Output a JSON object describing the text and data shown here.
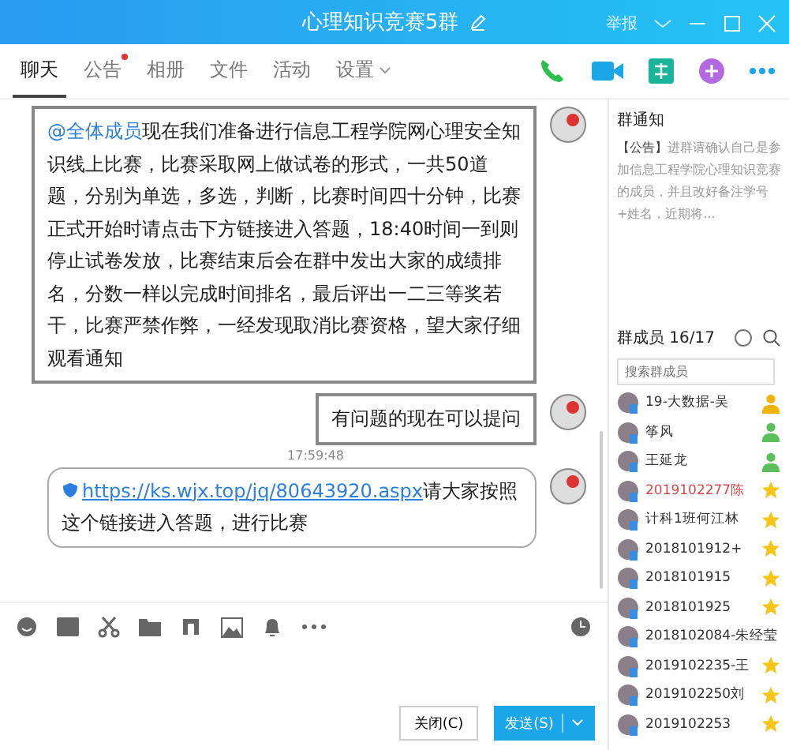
{
  "window": {
    "title": "心理知识竞赛5群",
    "menu_label": "举报"
  },
  "tabs": [
    {
      "label": "聊天",
      "selected": true,
      "badge": false
    },
    {
      "label": "公告",
      "selected": false,
      "badge": true
    },
    {
      "label": "相册",
      "selected": false,
      "badge": false
    },
    {
      "label": "文件",
      "selected": false,
      "badge": false
    },
    {
      "label": "活动",
      "selected": false,
      "badge": false
    },
    {
      "label": "设置",
      "selected": false,
      "badge": false,
      "dropdown": true
    }
  ],
  "messages": [
    {
      "kind": "notice",
      "mention": "@全体成员",
      "text": "现在我们准备进行信息工程学院网心理安全知识线上比赛，比赛采取网上做试卷的形式，一共50道题，分别为单选，多选，判断，比赛时间四十分钟，比赛正式开始时请点击下方链接进入答题，18:40时间一到则停止试卷发放，比赛结束后会在群中发出大家的成绩排名，分数一样以完成时间排名，最后评出一二三等奖若干，比赛严禁作弊，一经发现取消比赛资格，望大家仔细观看通知"
    },
    {
      "kind": "notice",
      "text": "有问题的现在可以提问"
    },
    {
      "kind": "time",
      "text": "17:59:48"
    },
    {
      "kind": "link",
      "link": "https://ks.wjx.top/jq/80643920.aspx",
      "text": "请大家按照这个链接进入答题，进行比赛"
    }
  ],
  "buttons": {
    "close": "关闭(C)",
    "send": "发送(S)"
  },
  "notice": {
    "title": "群通知",
    "tag": "【公告】",
    "text": "进群请确认自己是参加信息工程学院心理知识竞赛的成员，并且改好备注学号+姓名，近期将..."
  },
  "members": {
    "title": "群成员 16/17",
    "search_placeholder": "搜索群成员",
    "items": [
      {
        "name": "19-大数据-吴",
        "kind": "owner",
        "highlight": false
      },
      {
        "name": "筝风",
        "kind": "admin",
        "highlight": false
      },
      {
        "name": "王延龙",
        "kind": "admin",
        "highlight": false
      },
      {
        "name": "2019102277陈",
        "kind": "star",
        "highlight": true
      },
      {
        "name": "计科1班何江林",
        "kind": "star",
        "highlight": false
      },
      {
        "name": "2018101912+",
        "kind": "star",
        "highlight": false
      },
      {
        "name": "2018101915",
        "kind": "star",
        "highlight": false
      },
      {
        "name": "2018101925",
        "kind": "star",
        "highlight": false
      },
      {
        "name": "2018102084-朱经莹",
        "kind": "none",
        "highlight": false
      },
      {
        "name": "2019102235-王",
        "kind": "star",
        "highlight": false
      },
      {
        "name": "2019102250刘",
        "kind": "star",
        "highlight": false
      },
      {
        "name": "2019102253",
        "kind": "star",
        "highlight": false
      }
    ]
  }
}
